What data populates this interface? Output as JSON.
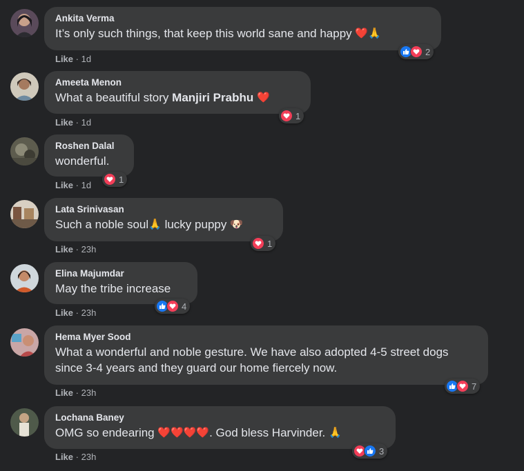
{
  "comments": [
    {
      "name": "Ankita Verma",
      "text": "It’s only such things, that keep this world sane and happy",
      "emoji_after": "❤️🙏",
      "time": "1d",
      "reaction_icons": [
        "like-icon",
        "love-icon"
      ],
      "reaction_count": "2",
      "avatar_color": "#4a3b4a"
    },
    {
      "name": "Ameeta Menon",
      "text": "What a beautiful story",
      "mention": "Manjiri Prabhu",
      "emoji_after": "❤️",
      "time": "1d",
      "reaction_icons": [
        "love-icon"
      ],
      "reaction_count": "1",
      "avatar_color": "#b9b3a6"
    },
    {
      "name": "Roshen Dalal",
      "text": "wonderful.",
      "time": "1d",
      "reaction_icons": [
        "love-icon"
      ],
      "reaction_count": "1",
      "avatar_color": "#6b6a5c"
    },
    {
      "name": "Lata Srinivasan",
      "text": "Such a noble soul",
      "emoji_mid": "🙏",
      "text_after": "lucky puppy",
      "emoji_after": "🐶",
      "time": "23h",
      "reaction_icons": [
        "love-icon"
      ],
      "reaction_count": "1",
      "avatar_color": "#8a6b55"
    },
    {
      "name": "Elina Majumdar",
      "text": "May the tribe increase",
      "time": "23h",
      "reaction_icons": [
        "like-icon",
        "love-icon"
      ],
      "reaction_count": "4",
      "avatar_color": "#c98a6a"
    },
    {
      "name": "Hema Myer Sood",
      "text": "What a wonderful and noble gesture. We have also adopted 4-5 street dogs since 3-4 years and they guard our home fiercely now.",
      "time": "23h",
      "reaction_icons": [
        "like-icon",
        "love-icon"
      ],
      "reaction_count": "7",
      "avatar_color": "#a0686a"
    },
    {
      "name": "Lochana Baney",
      "text": "OMG so endearing",
      "emoji_mid": "❤️❤️❤️❤️",
      "text_after": ". God bless Harvinder.",
      "emoji_after": "🙏",
      "time": "23h",
      "reaction_icons": [
        "love-icon",
        "like-icon"
      ],
      "reaction_count": "3",
      "avatar_color": "#5b6a55"
    }
  ],
  "like_label": "Like",
  "separator": "·",
  "colors": {
    "background": "#232426",
    "bubble": "#3a3b3c",
    "like_blue": "#1877f2",
    "love_red": "#f33e58"
  }
}
